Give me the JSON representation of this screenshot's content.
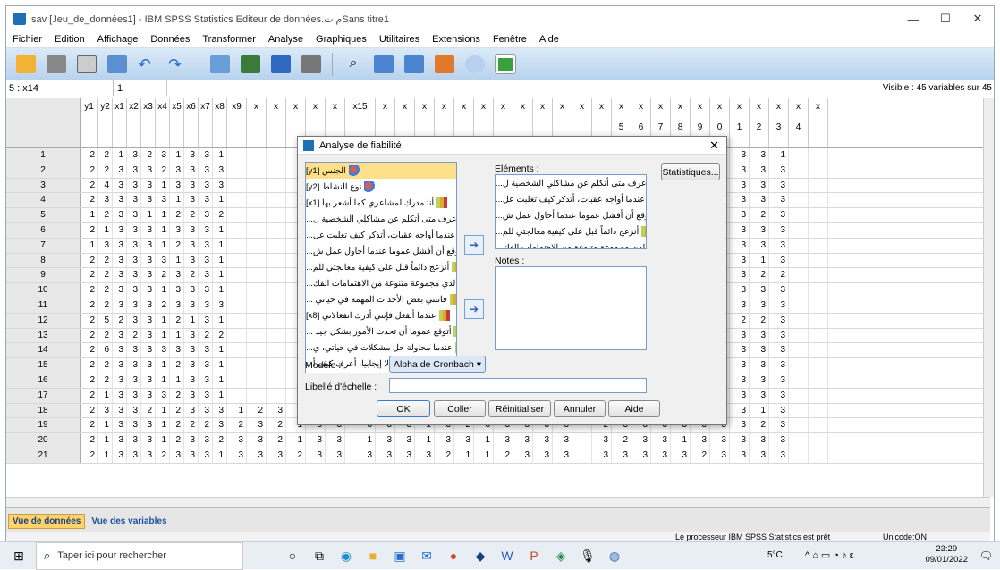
{
  "window": {
    "title": "sav [Jeu_de_données1] - IBM SPSS Statistics Editeur de données.م ت‌Sans titre1",
    "min": "—",
    "max": "☐",
    "close": "✕"
  },
  "menu": [
    "Fichier",
    "Edition",
    "Affichage",
    "Données",
    "Transformer",
    "Analyse",
    "Graphiques",
    "Utilitaires",
    "Extensions",
    "Fenêtre",
    "Aide"
  ],
  "cellbar": {
    "ref": "5 : x14",
    "value": "1",
    "visible": "Visible : 45 variables sur 45"
  },
  "columns": [
    "y1",
    "y2",
    "x1",
    "x2",
    "x3",
    "x4",
    "x5",
    "x6",
    "x7",
    "x8",
    "x9",
    "x",
    "x",
    "x",
    "x",
    "x",
    "x15",
    "x",
    "x",
    "x",
    "x",
    "x",
    "x",
    "x",
    "x",
    "x",
    "x",
    "x",
    "x",
    "x",
    "x",
    "x",
    "x",
    "x",
    "x",
    "x",
    "x",
    "x",
    "x",
    "x"
  ],
  "col_suffix": [
    "",
    "",
    "",
    "",
    "",
    "",
    "",
    "",
    "",
    "",
    "",
    "",
    "",
    "",
    "",
    "",
    "",
    "",
    "",
    "",
    "",
    "",
    "",
    "",
    "",
    "",
    "",
    "",
    "",
    "5",
    "6",
    "7",
    "8",
    "9",
    "0",
    "1",
    "2",
    "3",
    "4",
    ""
  ],
  "rows": [
    {
      "n": "1",
      "v": [
        "2",
        "2",
        "1",
        "3",
        "2",
        "3",
        "1",
        "3",
        "3",
        "1",
        "",
        "",
        "",
        "",
        "",
        "",
        "",
        "",
        "",
        "",
        "",
        "",
        "",
        "",
        "",
        "",
        "",
        "",
        "",
        "3",
        "3",
        "1",
        "3",
        "2",
        "1",
        "3",
        "3",
        "1"
      ]
    },
    {
      "n": "2",
      "v": [
        "2",
        "2",
        "3",
        "3",
        "3",
        "2",
        "3",
        "3",
        "3",
        "3",
        "",
        "",
        "",
        "",
        "",
        "",
        "",
        "",
        "",
        "",
        "",
        "",
        "",
        "",
        "",
        "",
        "",
        "",
        "",
        "3",
        "2",
        "3",
        "3",
        "3",
        "2",
        "3",
        "3",
        "3"
      ]
    },
    {
      "n": "3",
      "v": [
        "2",
        "4",
        "3",
        "3",
        "3",
        "1",
        "3",
        "3",
        "3",
        "3",
        "",
        "",
        "",
        "",
        "",
        "",
        "",
        "",
        "",
        "",
        "",
        "",
        "",
        "",
        "",
        "",
        "",
        "",
        "",
        "3",
        "2",
        "3",
        "3",
        "3",
        "1",
        "3",
        "3",
        "3"
      ]
    },
    {
      "n": "4",
      "v": [
        "2",
        "3",
        "3",
        "3",
        "3",
        "3",
        "1",
        "3",
        "3",
        "1",
        "",
        "",
        "",
        "",
        "",
        "",
        "",
        "",
        "",
        "",
        "",
        "",
        "",
        "",
        "",
        "",
        "",
        "",
        "",
        "3",
        "3",
        "3",
        "3",
        "3",
        "3",
        "3",
        "3",
        "3"
      ]
    },
    {
      "n": "5",
      "v": [
        "1",
        "2",
        "3",
        "3",
        "1",
        "1",
        "2",
        "2",
        "3",
        "2",
        "",
        "",
        "",
        "",
        "",
        "",
        "",
        "",
        "",
        "",
        "",
        "",
        "",
        "",
        "",
        "",
        "",
        "",
        "",
        "3",
        "3",
        "3",
        "3",
        "3",
        "1",
        "3",
        "2",
        "3"
      ]
    },
    {
      "n": "6",
      "v": [
        "2",
        "1",
        "3",
        "3",
        "3",
        "1",
        "3",
        "3",
        "3",
        "1",
        "",
        "",
        "",
        "",
        "",
        "",
        "",
        "",
        "",
        "",
        "",
        "",
        "",
        "",
        "",
        "",
        "",
        "",
        "",
        "3",
        "1",
        "3",
        "3",
        "3",
        "3",
        "3",
        "3",
        "3"
      ]
    },
    {
      "n": "7",
      "v": [
        "1",
        "3",
        "3",
        "3",
        "3",
        "1",
        "2",
        "3",
        "3",
        "1",
        "",
        "",
        "",
        "",
        "",
        "",
        "",
        "",
        "",
        "",
        "",
        "",
        "",
        "",
        "",
        "",
        "",
        "",
        "",
        "3",
        "3",
        "3",
        "3",
        "2",
        "3",
        "3",
        "3",
        "3"
      ]
    },
    {
      "n": "8",
      "v": [
        "2",
        "2",
        "3",
        "3",
        "3",
        "3",
        "1",
        "3",
        "3",
        "1",
        "",
        "",
        "",
        "",
        "",
        "",
        "",
        "",
        "",
        "",
        "",
        "",
        "",
        "",
        "",
        "",
        "",
        "",
        "",
        "3",
        "3",
        "1",
        "3",
        "3",
        "1",
        "3",
        "1",
        "3"
      ]
    },
    {
      "n": "9",
      "v": [
        "2",
        "2",
        "3",
        "3",
        "3",
        "2",
        "3",
        "2",
        "3",
        "1",
        "",
        "",
        "",
        "",
        "",
        "",
        "",
        "",
        "",
        "",
        "",
        "",
        "",
        "",
        "",
        "",
        "",
        "",
        "",
        "3",
        "3",
        "2",
        "3",
        "3",
        "2",
        "3",
        "2",
        "2"
      ]
    },
    {
      "n": "10",
      "v": [
        "2",
        "2",
        "3",
        "3",
        "3",
        "1",
        "3",
        "3",
        "3",
        "1",
        "",
        "",
        "",
        "",
        "",
        "",
        "",
        "",
        "",
        "",
        "",
        "",
        "",
        "",
        "",
        "",
        "",
        "",
        "",
        "3",
        "1",
        "3",
        "3",
        "3",
        "1",
        "3",
        "3",
        "3"
      ]
    },
    {
      "n": "11",
      "v": [
        "2",
        "2",
        "3",
        "3",
        "3",
        "2",
        "3",
        "3",
        "3",
        "3",
        "",
        "",
        "",
        "",
        "",
        "",
        "",
        "",
        "",
        "",
        "",
        "",
        "",
        "",
        "",
        "",
        "",
        "",
        "",
        "3",
        "3",
        "3",
        "3",
        "3",
        "3",
        "3",
        "3",
        "3"
      ]
    },
    {
      "n": "12",
      "v": [
        "2",
        "5",
        "2",
        "3",
        "3",
        "1",
        "2",
        "1",
        "3",
        "1",
        "",
        "",
        "",
        "",
        "",
        "",
        "",
        "",
        "",
        "",
        "",
        "",
        "",
        "",
        "",
        "",
        "",
        "",
        "",
        "3",
        "1",
        "2",
        "3",
        "1",
        "3",
        "2",
        "2",
        "3"
      ]
    },
    {
      "n": "13",
      "v": [
        "2",
        "2",
        "3",
        "2",
        "3",
        "1",
        "1",
        "3",
        "2",
        "2",
        "",
        "",
        "",
        "",
        "",
        "",
        "",
        "",
        "",
        "",
        "",
        "",
        "",
        "",
        "",
        "",
        "",
        "",
        "",
        "3",
        "3",
        "3",
        "3",
        "3",
        "3",
        "3",
        "3",
        "3"
      ]
    },
    {
      "n": "14",
      "v": [
        "2",
        "6",
        "3",
        "3",
        "3",
        "3",
        "3",
        "3",
        "3",
        "1",
        "",
        "",
        "",
        "",
        "",
        "",
        "",
        "",
        "",
        "",
        "",
        "",
        "",
        "",
        "",
        "",
        "",
        "",
        "",
        "3",
        "3",
        "3",
        "3",
        "3",
        "3",
        "3",
        "3",
        "3"
      ]
    },
    {
      "n": "15",
      "v": [
        "2",
        "2",
        "3",
        "3",
        "3",
        "1",
        "2",
        "3",
        "3",
        "1",
        "",
        "",
        "",
        "",
        "",
        "",
        "",
        "",
        "",
        "",
        "",
        "",
        "",
        "",
        "",
        "",
        "",
        "",
        "",
        "3",
        "3",
        "3",
        "3",
        "2",
        "3",
        "3",
        "3",
        "3"
      ]
    },
    {
      "n": "16",
      "v": [
        "2",
        "2",
        "3",
        "3",
        "3",
        "1",
        "1",
        "3",
        "3",
        "1",
        "",
        "",
        "",
        "",
        "",
        "",
        "",
        "",
        "",
        "",
        "",
        "",
        "",
        "",
        "",
        "",
        "",
        "",
        "",
        "3",
        "3",
        "3",
        "3",
        "2",
        "3",
        "3",
        "3",
        "3"
      ]
    },
    {
      "n": "17",
      "v": [
        "2",
        "1",
        "3",
        "3",
        "3",
        "3",
        "2",
        "3",
        "3",
        "1",
        "",
        "",
        "",
        "",
        "",
        "",
        "",
        "",
        "",
        "",
        "",
        "",
        "",
        "",
        "",
        "",
        "",
        "",
        "",
        "3",
        "3",
        "3",
        "3",
        "2",
        "3",
        "3",
        "3",
        "3"
      ]
    },
    {
      "n": "18",
      "v": [
        "2",
        "3",
        "3",
        "3",
        "2",
        "1",
        "2",
        "3",
        "3",
        "3",
        "1",
        "2",
        "3",
        "",
        "1",
        "3",
        "3",
        "3",
        "3",
        "2",
        "3",
        "3",
        "1",
        "3",
        "1",
        "2",
        "1",
        "",
        "",
        "3",
        "3",
        "3",
        "3",
        "3",
        "2",
        "3",
        "1",
        "3"
      ]
    },
    {
      "n": "19",
      "v": [
        "2",
        "1",
        "3",
        "3",
        "3",
        "1",
        "2",
        "2",
        "2",
        "3",
        "2",
        "3",
        "2",
        "1",
        "3",
        "3",
        "3",
        "3",
        "3",
        "1",
        "3",
        "2",
        "3",
        "3",
        "3",
        "3",
        "3",
        "",
        "2",
        "3",
        "3",
        "3",
        "3",
        "3",
        "3",
        "3",
        "2",
        "3"
      ]
    },
    {
      "n": "20",
      "v": [
        "2",
        "1",
        "3",
        "3",
        "3",
        "1",
        "2",
        "3",
        "3",
        "2",
        "3",
        "3",
        "2",
        "1",
        "3",
        "3",
        "1",
        "3",
        "3",
        "1",
        "3",
        "3",
        "1",
        "3",
        "3",
        "3",
        "3",
        "",
        "3",
        "2",
        "3",
        "3",
        "1",
        "3",
        "3",
        "3",
        "3",
        "3"
      ]
    },
    {
      "n": "21",
      "v": [
        "2",
        "1",
        "3",
        "3",
        "3",
        "2",
        "3",
        "3",
        "3",
        "1",
        "3",
        "3",
        "3",
        "2",
        "3",
        "3",
        "3",
        "3",
        "3",
        "3",
        "2",
        "1",
        "1",
        "2",
        "3",
        "3",
        "3",
        "",
        "3",
        "3",
        "3",
        "3",
        "3",
        "2",
        "3",
        "3",
        "3",
        "3"
      ]
    }
  ],
  "tabs": {
    "data_view": "Vue de données",
    "variable_view": "Vue des variables"
  },
  "status": {
    "processor": "Le processeur IBM SPSS Statistics  est prêt",
    "unicode": "Unicode:ON"
  },
  "dialog": {
    "title": "Analyse de fiabilité",
    "close": "✕",
    "left_items": [
      "الجنس [y1]",
      "نوع النشاط [y2]",
      "أنا مدرك لمشاعري كما أشعر بها [x1]",
      "أعرف متى أتكلم عن مشاكلي الشخصية ل...",
      "عندما أواجه عقبات، أتذكر كيف تغلبت عل...",
      "أتوقع أن أفشل عموما عندما أحاول عمل ش...",
      "أنزعج دائماً قبل على كيفية معالجتي للم...",
      "لدي مجموعة متنوعة من الاهتمامات الفك...",
      "فاتنني بعض الأحداث المهمة في حياتي ...",
      "عندما أتفعل فإنني أدرك انفعالاتي [x8]",
      "أتوقع عموما أن تحدث الأمور بشكل جيد ...",
      "عندما محاولة حل مشكلات في حياتي، ي...",
      "عندما أعيش انفعالا إيجابيا، أعرف كيف أ..."
    ],
    "elements_label": "Eléments :",
    "right_items": [
      "أعرف متى أتكلم عن مشاكلي الشخصية ل...",
      "عندما أواجه عقبات، أتذكر كيف تغلبت عل...",
      "أتوقع أن أفشل عموما عندما أحاول عمل ش...",
      "أنزعج دائماً قبل على كيفية معالجتي للم...",
      "لدي مجموعة متنوعة من الاهتمامات الفك...",
      "أنا مدرك لمشاعري كما أشعر بها [x1]"
    ],
    "notes_label": "Notes :",
    "stats_button": "Statistiques...",
    "model_label": "Modèle :",
    "model_value": "Alpha de Cronbach",
    "scale_label": "Libellé d'échelle :",
    "scale_value": "",
    "ok": "OK",
    "paste": "Coller",
    "reset": "Réinitialiser",
    "cancel": "Annuler",
    "help": "Aide"
  },
  "taskbar": {
    "search_placeholder": "Taper ici pour rechercher",
    "weather": "5°C",
    "time": "23:29",
    "date": "09/01/2022"
  }
}
